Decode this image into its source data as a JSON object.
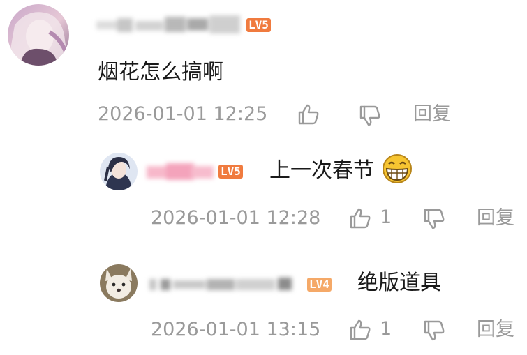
{
  "colors": {
    "lv5": "#f07b3f",
    "lv4": "#f5a968",
    "meta_text": "#9a9a9a",
    "body_text": "#1a1a1a",
    "name_blur_main": "#b8b8b8",
    "name_blur_pink": "#f4a3bb"
  },
  "comments": [
    {
      "level": "LV5",
      "text": "烟花怎么搞啊",
      "time": "2026-01-01 12:25",
      "like_icon": "thumb-up-icon",
      "dislike_icon": "thumb-down-icon",
      "reply_label": "回复",
      "replies": [
        {
          "level": "LV5",
          "text": "上一次春节",
          "emoji": "grinning-face-icon",
          "time": "2026-01-01 12:28",
          "likes": "1",
          "reply_label": "回复"
        },
        {
          "level": "LV4",
          "text": "绝版道具",
          "time": "2026-01-01 13:15",
          "likes": "1",
          "reply_label": "回复"
        }
      ]
    }
  ]
}
